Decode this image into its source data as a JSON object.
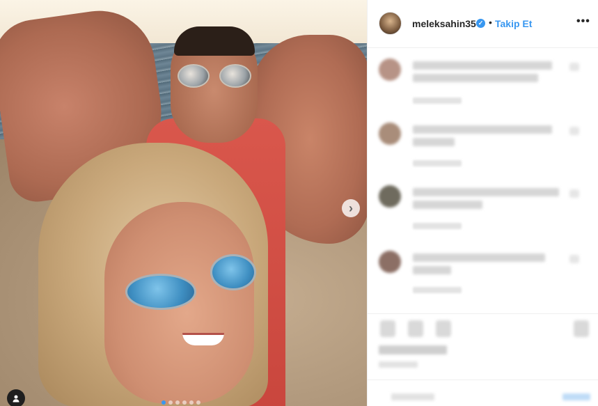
{
  "post": {
    "photo": {
      "carousel_dots": 6,
      "active_dot": 1,
      "next_icon": "chevron-right-icon",
      "user_tag_icon": "user-icon"
    },
    "header": {
      "username": "meleksahin35",
      "verified_icon": "verified-badge-icon",
      "separator": "•",
      "follow_label": "Takip Et",
      "more_icon": "more-options-icon",
      "more_glyph": "•••"
    },
    "comments_blurred": true,
    "action_icons": [
      "heart-icon",
      "comment-icon",
      "share-icon",
      "bookmark-icon"
    ]
  },
  "colors": {
    "accent": "#3897f0",
    "text": "#262626",
    "border": "#efefef"
  }
}
